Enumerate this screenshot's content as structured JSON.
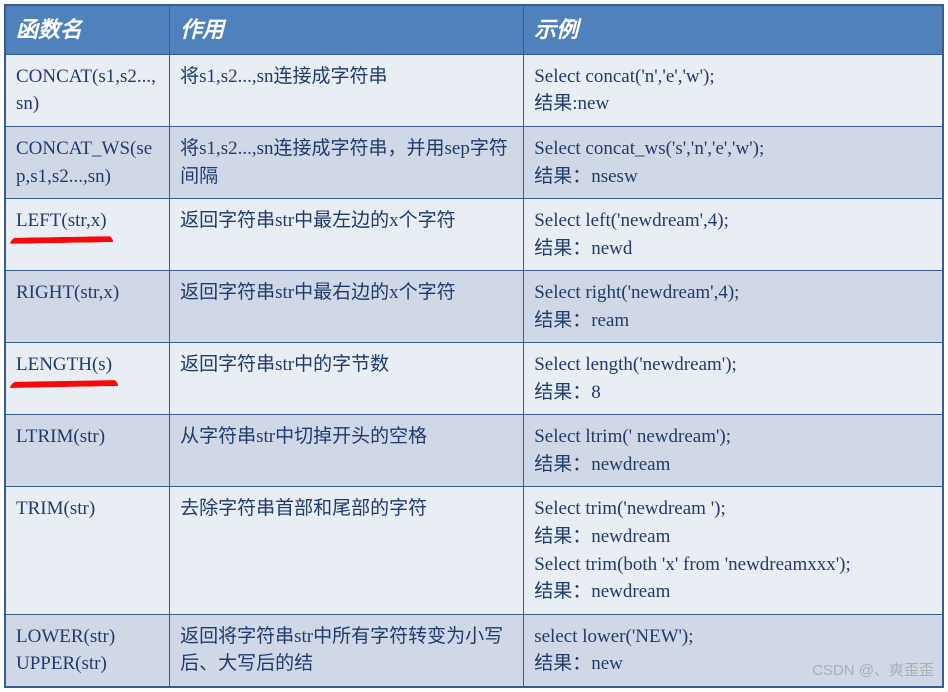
{
  "headers": [
    "函数名",
    "作用",
    "示例"
  ],
  "rows": [
    {
      "name": "CONCAT(s1,s2...,sn)",
      "desc": "将s1,s2...,sn连接成字符串",
      "example": "Select concat('n','e','w');\n结果:new",
      "marked": false
    },
    {
      "name": "CONCAT_WS(sep,s1,s2...,sn)",
      "desc": "将s1,s2...,sn连接成字符串，并用sep字符间隔",
      "example": "Select concat_ws('s','n','e','w');\n结果：nsesw",
      "marked": false
    },
    {
      "name": "LEFT(str,x)",
      "desc": "返回字符串str中最左边的x个字符",
      "example": "Select left('newdream',4);\n结果：newd",
      "marked": true
    },
    {
      "name": "RIGHT(str,x)",
      "desc": "返回字符串str中最右边的x个字符",
      "example": "Select  right('newdream',4);\n结果：ream",
      "marked": false
    },
    {
      "name": "LENGTH(s)",
      "desc": "返回字符串str中的字节数",
      "example": "Select length('newdream');\n结果：8",
      "marked": true
    },
    {
      "name": "LTRIM(str)",
      "desc": "从字符串str中切掉开头的空格",
      "example": "Select ltrim('   newdream');\n结果：newdream",
      "marked": false
    },
    {
      "name": "TRIM(str)",
      "desc": "去除字符串首部和尾部的字符",
      "example": "Select  trim('newdream  ');\n结果：newdream\nSelect  trim(both 'x' from 'newdreamxxx');\n结果：newdream",
      "marked": false
    },
    {
      "name": "LOWER(str)\nUPPER(str)",
      "desc": "返回将字符串str中所有字符转变为小写后、大写后的结",
      "example": "select lower('NEW');\n结果：new",
      "marked": false
    }
  ],
  "watermark": "CSDN @、爽歪歪"
}
